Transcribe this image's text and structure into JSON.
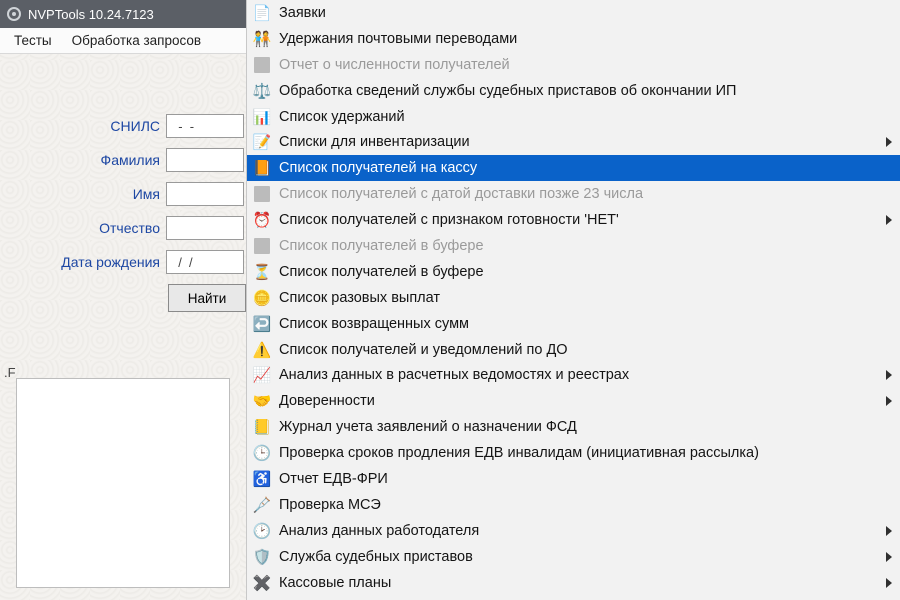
{
  "window": {
    "title": "NVPTools 10.24.7123"
  },
  "menubar": {
    "items": [
      {
        "label": "Тесты"
      },
      {
        "label": "Обработка запросов"
      }
    ]
  },
  "form": {
    "snils": {
      "label": "СНИЛС",
      "value": "  -  -"
    },
    "familiya": {
      "label": "Фамилия",
      "value": ""
    },
    "imya": {
      "label": "Имя",
      "value": ""
    },
    "otchestvo": {
      "label": "Отчество",
      "value": ""
    },
    "dob": {
      "label": "Дата рождения",
      "value": "  /  /"
    },
    "find_button": "Найти"
  },
  "separator_label": ".F",
  "menu": {
    "items": [
      {
        "icon": "form-icon",
        "label": "Заявки",
        "disabled": false,
        "sub": false
      },
      {
        "icon": "post-hold-icon",
        "label": "Удержания почтовыми переводами",
        "disabled": false,
        "sub": false
      },
      {
        "icon": "gray-box",
        "label": "Отчет о численности получателей",
        "disabled": true,
        "sub": false
      },
      {
        "icon": "gavel-icon",
        "label": "Обработка сведений службы судебных приставов об окончании ИП",
        "disabled": false,
        "sub": false
      },
      {
        "icon": "table-icon",
        "label": "Список удержаний",
        "disabled": false,
        "sub": false
      },
      {
        "icon": "checklist-icon",
        "label": "Списки для инвентаризации",
        "disabled": false,
        "sub": true
      },
      {
        "icon": "folder-icon",
        "label": "Список получателей на кассу",
        "disabled": false,
        "sub": false,
        "selected": true
      },
      {
        "icon": "gray-box",
        "label": "Список получателей с датой доставки позже 23 числа",
        "disabled": true,
        "sub": false
      },
      {
        "icon": "clock-bell-icon",
        "label": "Список получателей с признаком готовности 'НЕТ'",
        "disabled": false,
        "sub": true
      },
      {
        "icon": "gray-box",
        "label": "Список получателей в буфере",
        "disabled": true,
        "sub": false
      },
      {
        "icon": "hourglass-icon",
        "label": "Список получателей в буфере",
        "disabled": false,
        "sub": false
      },
      {
        "icon": "coins-icon",
        "label": "Список разовых выплат",
        "disabled": false,
        "sub": false
      },
      {
        "icon": "return-icon",
        "label": "Список возвращенных сумм",
        "disabled": false,
        "sub": false
      },
      {
        "icon": "warning-icon",
        "label": "Список получателей и уведомлений по ДО",
        "disabled": false,
        "sub": false
      },
      {
        "icon": "chart-icon",
        "label": "Анализ данных в расчетных ведомостях и реестрах",
        "disabled": false,
        "sub": true
      },
      {
        "icon": "handshake-icon",
        "label": "Доверенности",
        "disabled": false,
        "sub": true
      },
      {
        "icon": "ledger-icon",
        "label": "Журнал учета заявлений о назначении ФСД",
        "disabled": false,
        "sub": false
      },
      {
        "icon": "clock-find-icon",
        "label": "Проверка сроков продления ЕДВ инвалидам (инициативная рассылка)",
        "disabled": false,
        "sub": false
      },
      {
        "icon": "wheelchair-icon",
        "label": "Отчет ЕДВ-ФРИ",
        "disabled": false,
        "sub": false
      },
      {
        "icon": "crutch-icon",
        "label": "Проверка МСЭ",
        "disabled": false,
        "sub": false
      },
      {
        "icon": "analysis-icon",
        "label": "Анализ данных работодателя",
        "disabled": false,
        "sub": true
      },
      {
        "icon": "badge-icon",
        "label": "Служба судебных приставов",
        "disabled": false,
        "sub": true
      },
      {
        "icon": "plan-icon",
        "label": "Кассовые планы",
        "disabled": false,
        "sub": true
      }
    ]
  },
  "icons": {
    "form-icon": "📄",
    "post-hold-icon": "🧑‍🤝‍🧑",
    "gavel-icon": "⚖️",
    "table-icon": "📊",
    "checklist-icon": "📝",
    "folder-icon": "📙",
    "clock-bell-icon": "⏰",
    "hourglass-icon": "⏳",
    "coins-icon": "🪙",
    "return-icon": "↩️",
    "warning-icon": "⚠️",
    "chart-icon": "📈",
    "handshake-icon": "🤝",
    "ledger-icon": "📒",
    "clock-find-icon": "🕒",
    "wheelchair-icon": "♿",
    "crutch-icon": "🩼",
    "analysis-icon": "🕑",
    "badge-icon": "🛡️",
    "plan-icon": "✖️"
  }
}
